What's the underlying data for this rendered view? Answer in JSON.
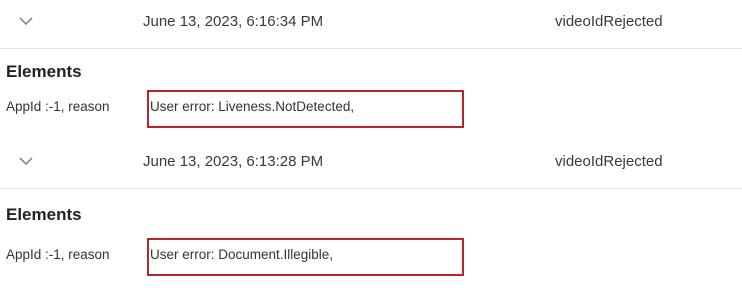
{
  "entries": [
    {
      "date": "June 13, 2023, 6:16:34 PM",
      "event": "videoIdRejected",
      "section_title": "Elements",
      "detail_prefix": "AppId :-1, reason",
      "detail_reason": "User error: Liveness.NotDetected,"
    },
    {
      "date": "June 13, 2023, 6:13:28 PM",
      "event": "videoIdRejected",
      "section_title": "Elements",
      "detail_prefix": "AppId :-1, reason",
      "detail_reason": "User error: Document.Illegible,"
    }
  ],
  "colors": {
    "highlight": "#b5272d",
    "chevron": "#8a8a8a",
    "divider": "#e2e2e2"
  }
}
